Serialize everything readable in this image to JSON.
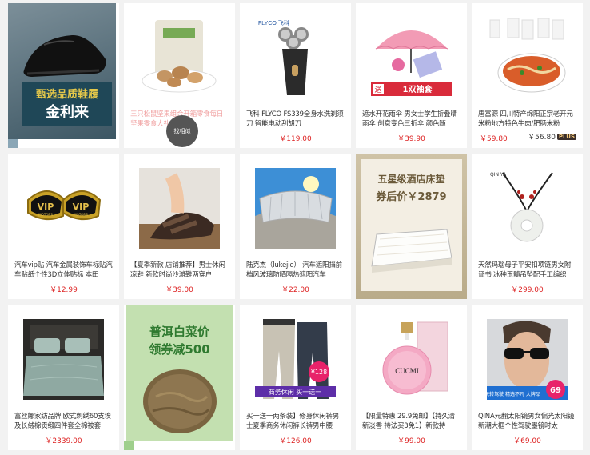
{
  "products": [
    {
      "banner_line1": "甄选品质鞋履",
      "banner_line2": "金利来",
      "banner_colors": {
        "bg": "#556e7b",
        "band": "#1f4757",
        "accent": "#e5c84a"
      },
      "icon": "shoe-icon"
    },
    {
      "title": "三只松鼠坚果组合开箱零食每日坚果零食大礼包",
      "similar_label": "找相似",
      "icon": "nuts-icon",
      "faded": true
    },
    {
      "title": "飞科 FLYCO FS339全身水洗剃须刀 智能电动刮胡刀",
      "price": "￥119.00",
      "logo": "FLYCO 飞科",
      "icon": "razor-icon"
    },
    {
      "title": "遮水开花雨伞 男女士学生折叠晴雨伞 创意变色三折伞 颜色随",
      "price": "￥39.90",
      "promo_badge": "1双袖套",
      "tag": "遇水开花",
      "icon": "umbrella-icon"
    },
    {
      "title": "唐富源 四川特产绵阳正宗老开元米粉地方特色牛肉/肥肠米粉",
      "price": "￥59.80",
      "plus_price": "￥56.80",
      "plus_label": "PLUS",
      "product_name_art": "唐富源",
      "icon": "noodles-icon"
    },
    {
      "title": "汽车vip贴 汽车金属装饰车标贴汽车贴纸个性3D立体贴标 本田",
      "price": "￥12.99",
      "vip_text": "VIP",
      "motors_text": "MOTORS",
      "icon": "vip-badge-icon"
    },
    {
      "title": "【夏季新款 店铺推荐】男士休闲凉鞋 新款时尚沙滩鞋两穿户",
      "price": "￥39.00",
      "icon": "sandal-icon"
    },
    {
      "title": "陆克杰（lukejie） 汽车遮阳挡前档风玻璃防晒隔热遮阳汽车",
      "price": "￥22.00",
      "icon": "sunshade-icon"
    },
    {
      "banner_line1": "五星级酒店床垫",
      "banner_line2": "券后价￥2879",
      "icon": "mattress-icon"
    },
    {
      "title": "天然玛瑙母子平安扣项链男女附证书 冰种玉髓吊坠配手工编织",
      "price": "￥299.00",
      "brand_text": "QIN YA",
      "icon": "necklace-icon"
    },
    {
      "title": "富丝娜家纺品牌 欧式刺绣60支埃及长绒棉贡缎四件套全棉被套",
      "price": "￥2339.00",
      "icon": "bedding-icon"
    },
    {
      "banner_line1": "普洱白菜价",
      "banner_line2": "领券减500",
      "icon": "tea-cake-icon"
    },
    {
      "title": "买一送一两条装】修身休闲裤男士夏季商务休闲裤长裤男中腰",
      "price": "￥126.00",
      "badge_price": "¥128",
      "promo_strip": "商务休闲 买一送一",
      "icon": "pants-icon"
    },
    {
      "title": "【限量特惠 29.9免邮】【持久清新淡香 持法买3免1】新款持",
      "price": "￥99.00",
      "bottle_text": "CUCMI",
      "icon": "perfume-icon"
    },
    {
      "title": "QINA元翻太阳镜男女偏光太阳镜 新潮大框个性驾驶墨镜时太",
      "price": "￥69.00",
      "badge_price": "69",
      "promo_strip": "玩转驾驶 精选不凡 大牌品",
      "icon": "sunglasses-icon"
    }
  ]
}
